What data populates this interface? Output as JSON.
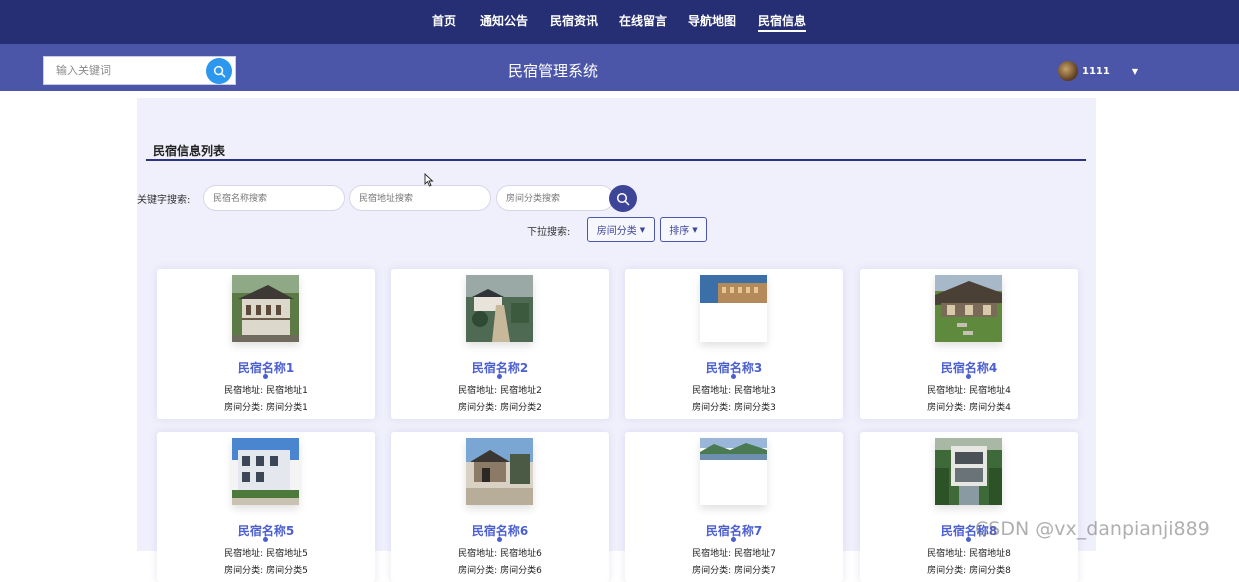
{
  "nav": {
    "items": [
      {
        "label": "首页"
      },
      {
        "label": "通知公告"
      },
      {
        "label": "民宿资讯"
      },
      {
        "label": "在线留言"
      },
      {
        "label": "导航地图"
      },
      {
        "label": "民宿信息"
      }
    ],
    "active": "民宿信息"
  },
  "header": {
    "search_placeholder": "输入关键词",
    "title": "民宿管理系统",
    "user_name": "1111"
  },
  "section": {
    "title": "民宿信息列表"
  },
  "filters": {
    "keyword_label": "关键字搜索:",
    "name_placeholder": "民宿名称搜索",
    "address_placeholder": "民宿地址搜索",
    "category_placeholder": "房间分类搜索",
    "dropdown_label": "下拉搜索:",
    "category_button": "房间分类",
    "sort_button": "排序"
  },
  "cards": [
    {
      "name": "民宿名称1",
      "address_label": "民宿地址:",
      "address": "民宿地址1",
      "category_label": "房间分类:",
      "category": "房间分类1"
    },
    {
      "name": "民宿名称2",
      "address_label": "民宿地址:",
      "address": "民宿地址2",
      "category_label": "房间分类:",
      "category": "房间分类2"
    },
    {
      "name": "民宿名称3",
      "address_label": "民宿地址:",
      "address": "民宿地址3",
      "category_label": "房间分类:",
      "category": "房间分类3"
    },
    {
      "name": "民宿名称4",
      "address_label": "民宿地址:",
      "address": "民宿地址4",
      "category_label": "房间分类:",
      "category": "房间分类4"
    },
    {
      "name": "民宿名称5",
      "address_label": "民宿地址:",
      "address": "民宿地址5",
      "category_label": "房间分类:",
      "category": "房间分类5"
    },
    {
      "name": "民宿名称6",
      "address_label": "民宿地址:",
      "address": "民宿地址6",
      "category_label": "房间分类:",
      "category": "房间分类6"
    },
    {
      "name": "民宿名称7",
      "address_label": "民宿地址:",
      "address": "民宿地址7",
      "category_label": "房间分类:",
      "category": "房间分类7"
    },
    {
      "name": "民宿名称8",
      "address_label": "民宿地址:",
      "address": "民宿地址8",
      "category_label": "房间分类:",
      "category": "房间分类8"
    }
  ],
  "watermark": "CSDN @vx_danpianji889",
  "colors": {
    "nav_bg": "#262f73",
    "subheader_bg": "#4c56a8",
    "content_bg": "#f0f0fc",
    "accent_blue": "#2b97ee",
    "card_title": "#4c5fd0"
  },
  "icons": [
    "search-icon",
    "chevron-down-icon",
    "avatar",
    "cursor-icon"
  ]
}
